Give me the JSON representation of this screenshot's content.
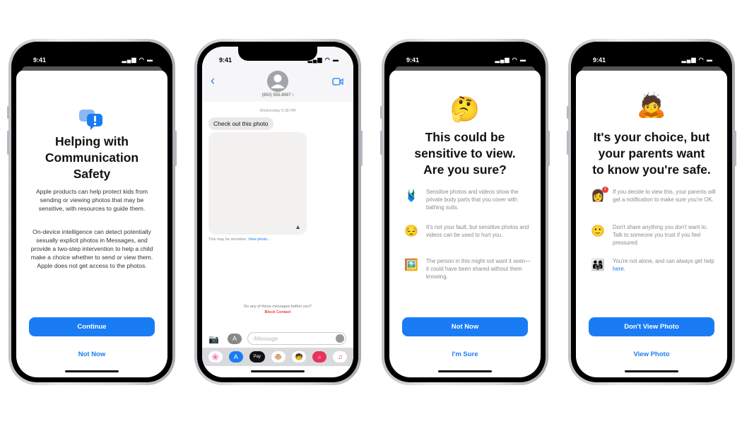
{
  "status_time": "9:41",
  "phone1": {
    "title": [
      "Helping with",
      "Communication",
      "Safety"
    ],
    "para1": "Apple products can help protect kids from sending or viewing photos that may be sensitive, with resources to guide them.",
    "para2": "On-device intelligence can detect potentially sexually explicit photos in Messages, and provide a two-step intervention to help a child make a choice whether to send or view them. Apple does not get access to the photos.",
    "primary": "Continue",
    "secondary": "Not Now",
    "icon": "chat-bubbles-exclamation-icon"
  },
  "phone2": {
    "contact": "(650) 555-8997 ›",
    "date": "Wednesday 5:38 PM",
    "bubble": "Check out this photo",
    "caption": "This may be sensitive.",
    "caption_link": "View photo...",
    "bother": "Do any of these messages bother you?",
    "block": "Block Contact",
    "input_placeholder": "iMessage",
    "apps": [
      "Photos",
      "App Store",
      "Apple Pay",
      "Memoji",
      "Memoji Stickers",
      "Search",
      "Music"
    ],
    "apple_pay_label": "Pay"
  },
  "phone3": {
    "emoji": "🤔",
    "title": [
      "This could be",
      "sensitive to view.",
      "Are you sure?"
    ],
    "items": [
      {
        "emoji": "🩱",
        "text": "Sensitive photos and videos show the private body parts that you cover with bathing suits."
      },
      {
        "emoji": "😔",
        "text": "It's not your fault, but sensitive photos and videos can be used to hurt you."
      },
      {
        "emoji": "🖼️",
        "text": "The person in this might not want it seen—it could have been shared without them knowing."
      }
    ],
    "primary": "Not Now",
    "secondary": "I'm Sure"
  },
  "phone4": {
    "emoji": "🙇",
    "title": [
      "It's your choice, but",
      "your parents want",
      "to know you're safe."
    ],
    "items": [
      {
        "emoji": "👩",
        "text": "If you decide to view this, your parents will get a notification to make sure you're OK.",
        "badge": "1"
      },
      {
        "emoji": "🙂",
        "text": "Don't share anything you don't want to. Talk to someone you trust if you feel pressured."
      },
      {
        "emoji": "👨‍👩‍👧",
        "text": "You're not alone, and can always get help",
        "link": "here."
      }
    ],
    "primary": "Don't View Photo",
    "secondary": "View Photo"
  },
  "colors": {
    "accent": "#1a7cf5",
    "danger": "#e8403a"
  }
}
